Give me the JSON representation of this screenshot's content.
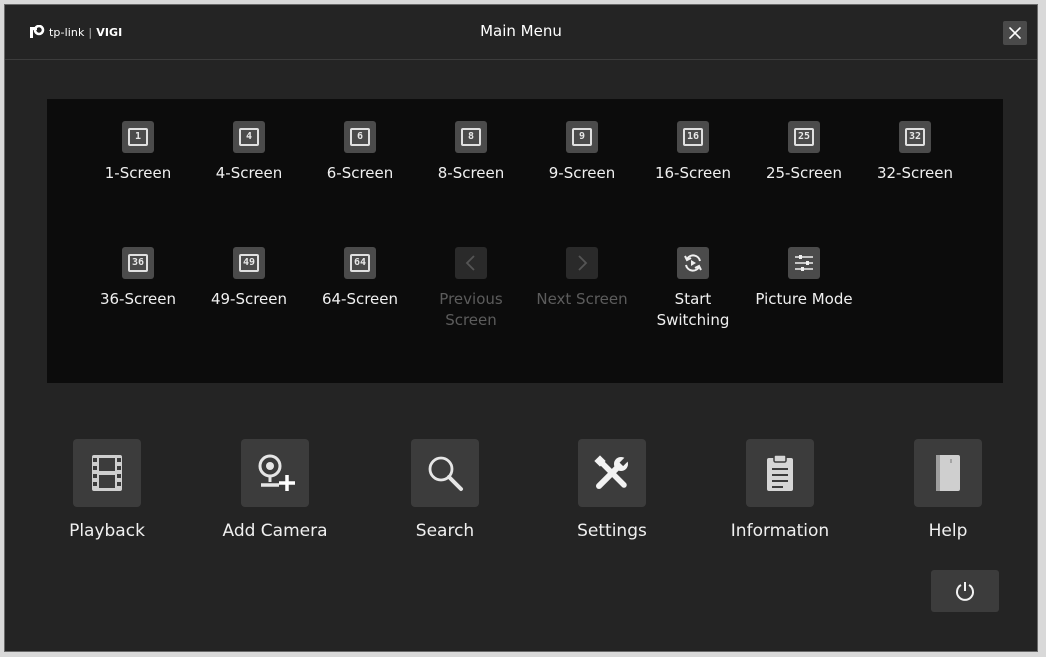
{
  "window": {
    "title": "Main Menu",
    "logo_brand": "tp-link",
    "logo_sep": "|",
    "logo_product": "VIGI"
  },
  "screens_row1": [
    {
      "label": "1-Screen",
      "num": "1"
    },
    {
      "label": "4-Screen",
      "num": "4"
    },
    {
      "label": "6-Screen",
      "num": "6"
    },
    {
      "label": "8-Screen",
      "num": "8"
    },
    {
      "label": "9-Screen",
      "num": "9"
    },
    {
      "label": "16-Screen",
      "num": "16"
    },
    {
      "label": "25-Screen",
      "num": "25"
    },
    {
      "label": "32-Screen",
      "num": "32"
    }
  ],
  "screens_row2": [
    {
      "label": "36-Screen",
      "num": "36"
    },
    {
      "label": "49-Screen",
      "num": "49"
    },
    {
      "label": "64-Screen",
      "num": "64"
    },
    {
      "label": "Previous Screen",
      "icon": "chevron-left-icon",
      "disabled": true
    },
    {
      "label": "Next Screen",
      "icon": "chevron-right-icon",
      "disabled": true
    },
    {
      "label": "Start Switching",
      "icon": "cycle-icon"
    },
    {
      "label": "Picture Mode",
      "icon": "sliders-icon"
    }
  ],
  "menu": [
    {
      "label": "Playback",
      "icon": "film-icon"
    },
    {
      "label": "Add Camera",
      "icon": "add-camera-icon"
    },
    {
      "label": "Search",
      "icon": "search-icon"
    },
    {
      "label": "Settings",
      "icon": "tools-icon"
    },
    {
      "label": "Information",
      "icon": "clipboard-icon"
    },
    {
      "label": "Help",
      "icon": "book-icon"
    }
  ],
  "power": {
    "icon": "power-icon"
  },
  "colors": {
    "background": "#242424",
    "panel": "#0c0c0c",
    "tile": "#4b4b4b",
    "disabled_text": "#5c5c5c"
  }
}
